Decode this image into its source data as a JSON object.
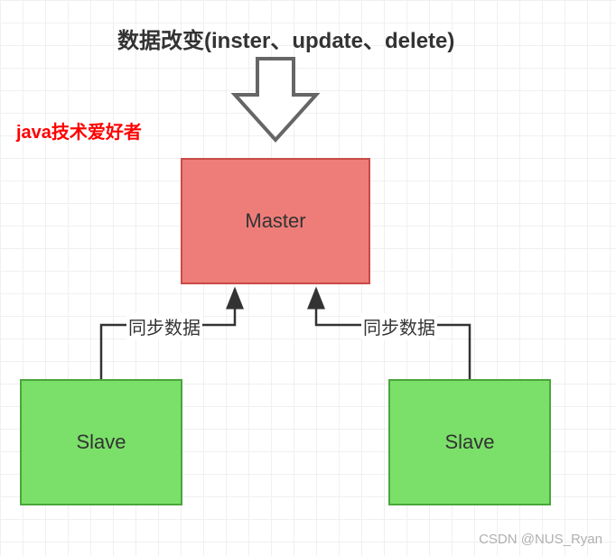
{
  "title": "数据改变(inster、update、delete)",
  "watermark_left": "java技术爱好者",
  "watermark_bottom": "CSDN @NUS_Ryan",
  "nodes": {
    "master": "Master",
    "slave_left": "Slave",
    "slave_right": "Slave"
  },
  "edges": {
    "sync_left": "同步数据",
    "sync_right": "同步数据"
  }
}
